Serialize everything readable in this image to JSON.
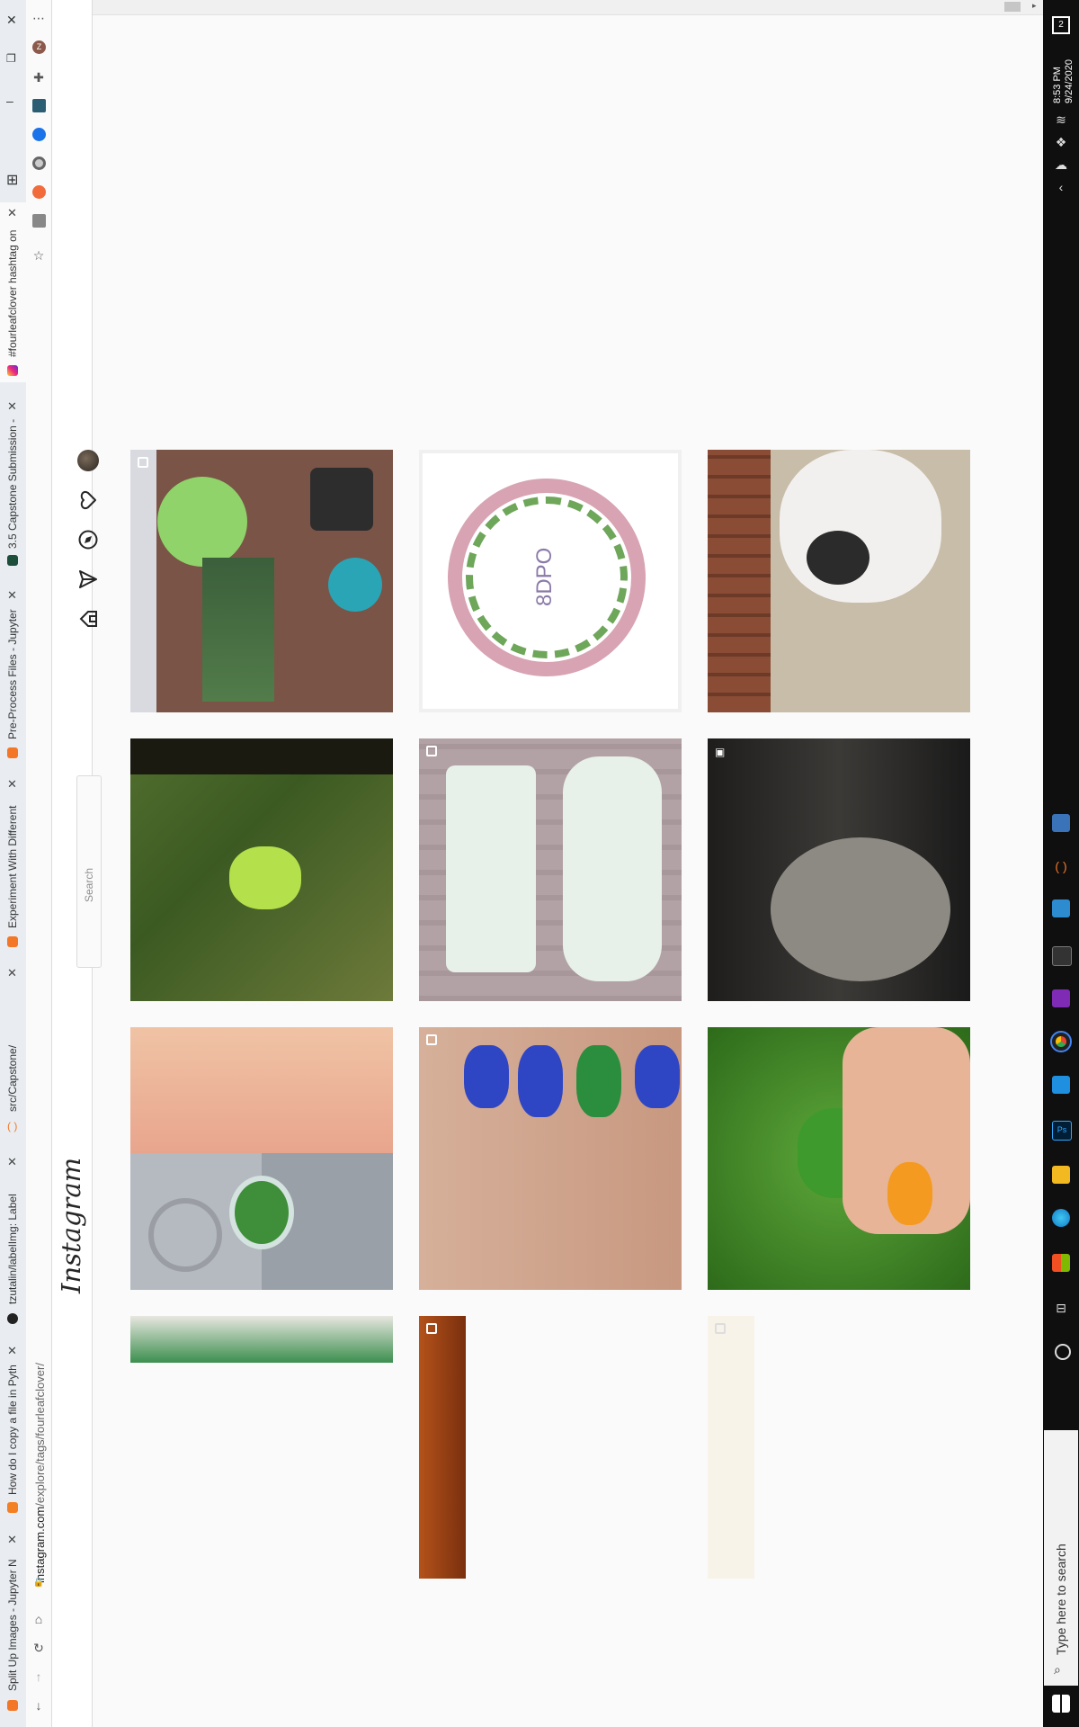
{
  "tabs": [
    {
      "title": "Split Up Images - Jupyter N",
      "active": false
    },
    {
      "title": "How do I copy a file in Pyth",
      "active": false
    },
    {
      "title": "tzutalin/labelImg: Label",
      "active": false
    },
    {
      "title": "src/Capstone/",
      "active": false
    },
    {
      "title": "Experiment With Different",
      "active": false
    },
    {
      "title": "Pre-Process Files - Jupyter",
      "active": false
    },
    {
      "title": "3.5 Capstone Submission -",
      "active": false
    },
    {
      "title": "#fourleafclover hashtag on",
      "active": true
    }
  ],
  "address_bar": {
    "domain": "instagram.com",
    "path": "/explore/tags/fourleafclover/"
  },
  "instagram": {
    "logo": "Instagram",
    "search_placeholder": "Search",
    "nav_icons": [
      "home-icon",
      "direct-icon",
      "explore-icon",
      "activity-heart-icon",
      "profile-avatar"
    ],
    "grid": [
      {
        "name": "post-plants-porch",
        "multi": true
      },
      {
        "name": "post-clover-grass",
        "multi": false
      },
      {
        "name": "post-clover-keychain",
        "multi": false
      },
      {
        "name": "post-green-pattern",
        "multi": false
      },
      {
        "name": "post-8dpo-wreath",
        "multi": false,
        "text": "8DPO"
      },
      {
        "name": "post-clover-onesie",
        "multi": true
      },
      {
        "name": "post-clover-nails",
        "multi": true
      },
      {
        "name": "post-orange-item",
        "multi": true
      },
      {
        "name": "post-dog-carpet",
        "multi": false
      },
      {
        "name": "post-video-machine",
        "multi": false,
        "video": true
      },
      {
        "name": "post-clover-hand",
        "multi": false
      },
      {
        "name": "post-white-flowers",
        "multi": true
      }
    ]
  },
  "taskbar": {
    "time": "8:53 PM",
    "date": "9/24/2020",
    "search_placeholder": "Type here to search",
    "notification_count": "2"
  },
  "colors": {
    "ig_border": "#dbdbdb",
    "tab_bg": "#e9edf2",
    "taskbar_bg": "#0f0f10"
  }
}
